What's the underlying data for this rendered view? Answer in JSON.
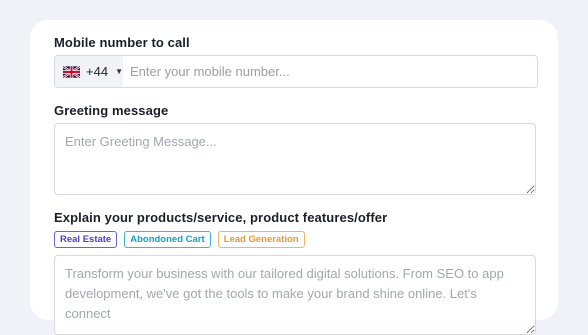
{
  "mobile": {
    "label": "Mobile number to call",
    "country_code": "+44",
    "flag_icon": "uk-flag-icon",
    "placeholder": "Enter your mobile number...",
    "value": ""
  },
  "greeting": {
    "label": "Greeting message",
    "placeholder": "Enter Greeting Message...",
    "value": ""
  },
  "products": {
    "label": "Explain your products/service, product features/offer",
    "tags": [
      {
        "label": "Real Estate",
        "color": "#4b3fc7"
      },
      {
        "label": "Abondoned Cart",
        "color": "#16a2c1"
      },
      {
        "label": "Lead Generation",
        "color": "#e69a3a"
      }
    ],
    "placeholder": "Transform your business with our tailored digital solutions. From SEO to app development, we've got the tools to make your brand shine online. Let's connect",
    "value": ""
  },
  "colors": {
    "background": "#f1f1f8",
    "card": "#ffffff",
    "border": "#d7d9e0"
  }
}
